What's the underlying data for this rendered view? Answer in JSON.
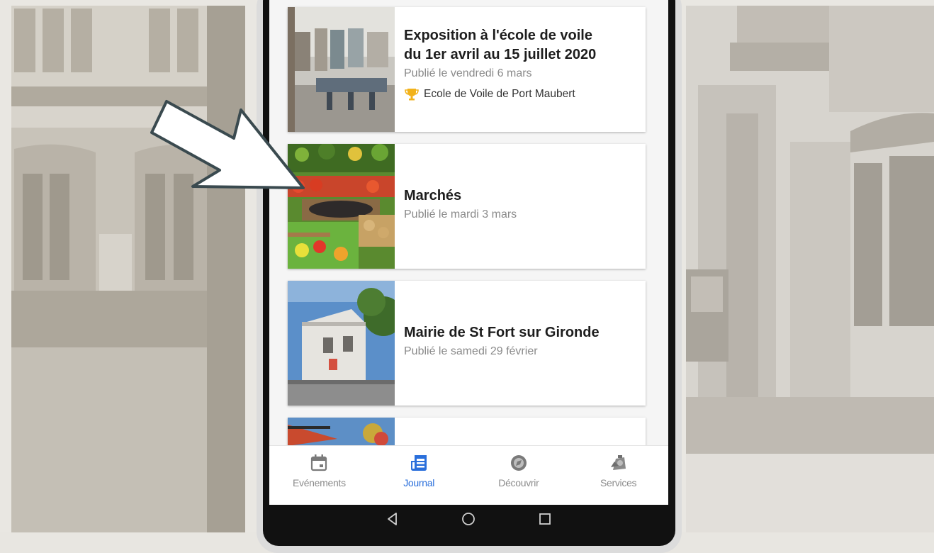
{
  "colors": {
    "accent": "#2a6fdb",
    "muted": "#8c8c8c",
    "trophy": "#f2b21a"
  },
  "feed": {
    "items": [
      {
        "title_line1": "Exposition à l'école de voile",
        "title_line2": "du 1er avril au 15 juillet 2020",
        "published": "Publié le vendredi 6 mars",
        "organizer": "Ecole de Voile de Port Maubert",
        "organizer_icon": "trophy-icon"
      },
      {
        "title": "Marchés",
        "published": "Publié le mardi 3 mars"
      },
      {
        "title": "Mairie de St Fort sur Gironde",
        "published": "Publié le samedi 29 février"
      }
    ]
  },
  "bottom_nav": {
    "active": "Journal",
    "items": [
      {
        "label": "Evénements",
        "icon": "calendar-icon"
      },
      {
        "label": "Journal",
        "icon": "newspaper-icon"
      },
      {
        "label": "Découvrir",
        "icon": "compass-icon"
      },
      {
        "label": "Services",
        "icon": "services-icon"
      }
    ]
  },
  "system_nav": {
    "icons": [
      "back-icon",
      "home-icon",
      "recents-icon"
    ]
  }
}
